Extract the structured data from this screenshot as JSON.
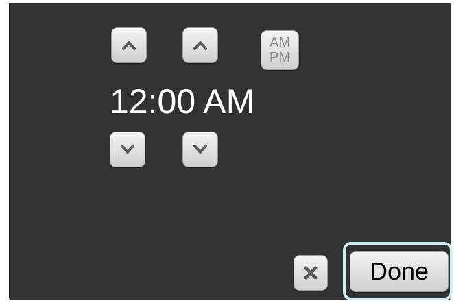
{
  "time_picker": {
    "time": "12:00 AM",
    "ampm_toggle": {
      "am": "AM",
      "pm": "PM"
    },
    "controls": {
      "hour_up_icon": "chevron-up-icon",
      "minute_up_icon": "chevron-up-icon",
      "hour_down_icon": "chevron-down-icon",
      "minute_down_icon": "chevron-down-icon"
    }
  },
  "footer": {
    "cancel_icon": "close-icon",
    "done_label": "Done"
  },
  "colors": {
    "panel_background": "#323232",
    "focus_ring": "#cdeef3",
    "button_text": "#000000",
    "icon_color": "#5a5a5a"
  }
}
